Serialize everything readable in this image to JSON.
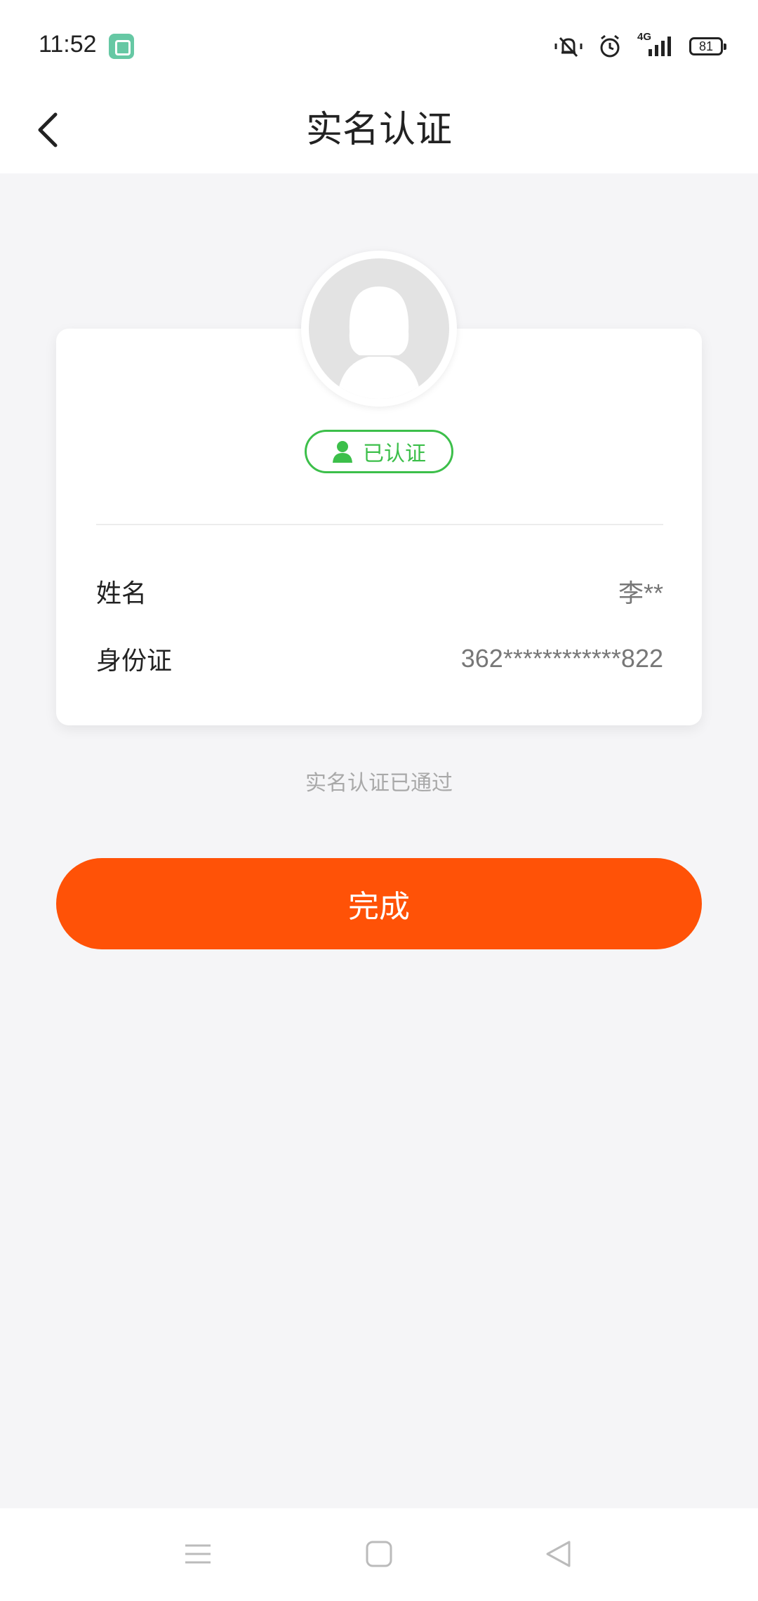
{
  "status_bar": {
    "time": "11:52",
    "network": "4G",
    "battery_level": "81",
    "icons": [
      "app-notification-icon",
      "vibrate-mute-icon",
      "alarm-icon",
      "signal-4g-icon",
      "battery-icon"
    ]
  },
  "header": {
    "title": "实名认证",
    "back_icon": "chevron-left-icon"
  },
  "card": {
    "avatar_icon": "default-female-avatar",
    "badge": {
      "icon": "user-icon",
      "label": "已认证",
      "color": "#3cbf4a"
    },
    "rows": [
      {
        "label": "姓名",
        "value": "李**"
      },
      {
        "label": "身份证",
        "value": "362************822"
      }
    ]
  },
  "status_note": "实名认证已通过",
  "actions": {
    "done_label": "完成",
    "accent_color": "#ff5207"
  },
  "system_nav": {
    "icons": [
      "menu-icon",
      "home-icon",
      "back-triangle-icon"
    ]
  }
}
